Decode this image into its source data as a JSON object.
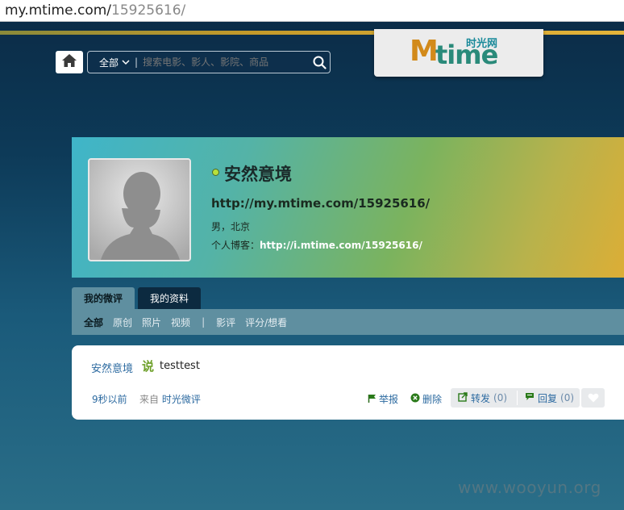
{
  "browser": {
    "url_domain": "my.mtime.com/",
    "url_path": "15925616/"
  },
  "header": {
    "search_scope": "全部",
    "search_placeholder": "搜索电影、影人、影院、商品",
    "logo_letter_m": "M",
    "logo_text": "time",
    "logo_cn": "时光网"
  },
  "profile": {
    "name": "安然意境",
    "url": "http://my.mtime.com/15925616/",
    "gender_location": "男，北京",
    "blog_label": "个人博客：",
    "blog_url": "http://i.mtime.com/15925616/"
  },
  "tabs": [
    {
      "label": "我的微评",
      "active": true
    },
    {
      "label": "我的资料",
      "active": false
    }
  ],
  "subnav": {
    "items_a": [
      "全部",
      "原创",
      "照片",
      "视频"
    ],
    "separator": "|",
    "items_b": [
      "影评",
      "评分/想看"
    ]
  },
  "post": {
    "author": "安然意境",
    "says": "说",
    "text": "testtest",
    "time": "9秒以前",
    "from_label": "来自",
    "client": "时光微评",
    "report": "举报",
    "delete": "删除",
    "forward": "转发",
    "forward_count": "(0)",
    "reply": "回复",
    "reply_count": "(0)"
  },
  "watermark": "www.wooyun.org",
  "colors": {
    "link": "#2c6aa0",
    "accent_green": "#6ea02a",
    "page_bg": "#0d3a58"
  }
}
